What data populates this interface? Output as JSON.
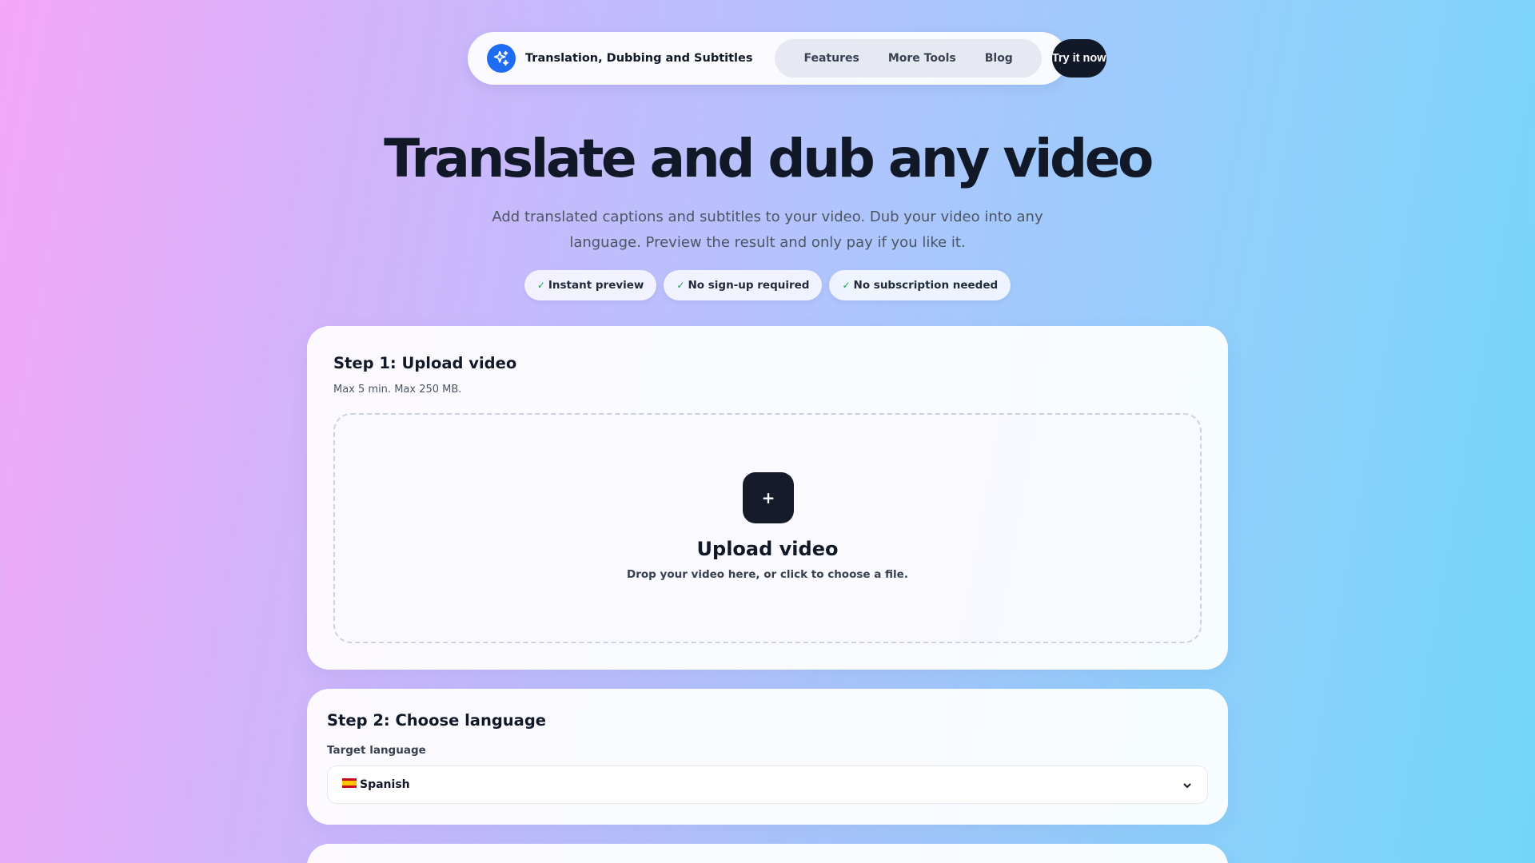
{
  "nav": {
    "brand": "Translation, Dubbing and Subtitles",
    "brand_icon": "sparkles-icon",
    "links": [
      "Features",
      "More Tools",
      "Blog"
    ],
    "cta": "Try it now"
  },
  "hero": {
    "title": "Translate and dub any video",
    "subtitle": "Add translated captions and subtitles to your video. Dub your video into any language. Preview the result and only pay if you like it.",
    "pills": [
      "Instant preview",
      "No sign-up required",
      "No subscription needed"
    ],
    "pill_icon": "check-icon"
  },
  "step1": {
    "title": "Step 1: Upload video",
    "note": "Max 5 min. Max 250 MB.",
    "upload_icon": "plus-icon",
    "upload_title": "Upload video",
    "upload_hint": "Drop your video here, or click to choose a file."
  },
  "step2": {
    "title": "Step 2: Choose language",
    "field_label": "Target language",
    "selected_flag": "spain-flag-icon",
    "selected_value": "Spanish"
  },
  "colors": {
    "accent_blue": "#1d6cf2",
    "dark": "#111827"
  }
}
